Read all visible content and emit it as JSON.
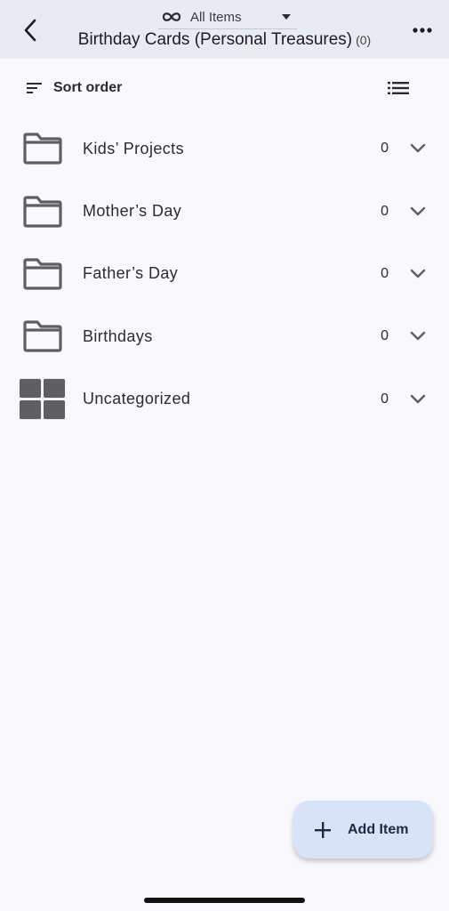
{
  "header": {
    "filter_label": "All Items",
    "title": "Birthday Cards (Personal Treasures)",
    "count": "(0)"
  },
  "toolbar": {
    "sort_label": "Sort order"
  },
  "list": {
    "items": [
      {
        "name": "Kids’ Projects",
        "count": "0",
        "icon": "folder-icon"
      },
      {
        "name": "Mother’s Day",
        "count": "0",
        "icon": "folder-icon"
      },
      {
        "name": "Father’s Day",
        "count": "0",
        "icon": "folder-icon"
      },
      {
        "name": "Birthdays",
        "count": "0",
        "icon": "folder-icon"
      },
      {
        "name": "Uncategorized",
        "count": "0",
        "icon": "grid-icon"
      }
    ]
  },
  "fab": {
    "label": "Add Item"
  },
  "colors": {
    "header_bg": "#e9ebf3",
    "page_bg": "#f9f8fd",
    "icon_gray": "#5f5f63",
    "fab_bg": "#d9e3f8"
  }
}
